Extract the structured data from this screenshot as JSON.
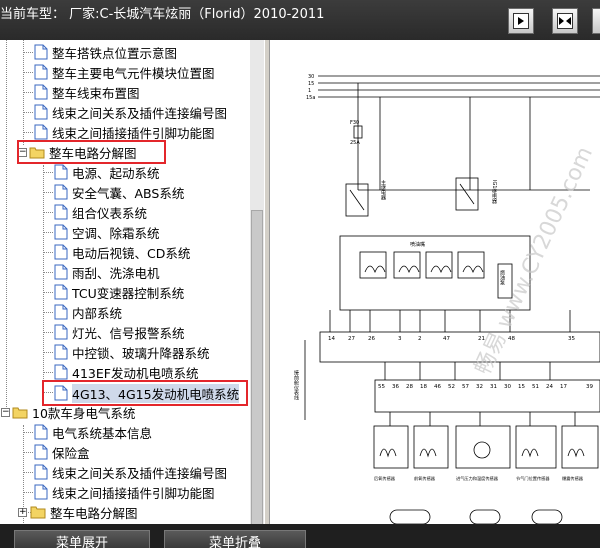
{
  "window": {
    "title": "当前车型：  厂家:C-长城汽车炫丽（Florid）2010-2011"
  },
  "toolbar": {
    "buttons": [
      {
        "name": "collapse-left-button",
        "icon": "arrow-right-box-icon"
      },
      {
        "name": "split-view-button",
        "icon": "double-arrow-box-icon"
      },
      {
        "name": "collapse-right-button",
        "icon": "arrow-left-box-icon"
      }
    ]
  },
  "tree": {
    "items": [
      {
        "label": "整车搭铁点位置示意图",
        "type": "doc"
      },
      {
        "label": "整车主要电气元件模块位置图",
        "type": "doc"
      },
      {
        "label": "整车线束布置图",
        "type": "doc"
      },
      {
        "label": "线束之间关系及插件连接编号图",
        "type": "doc"
      },
      {
        "label": "线束之间插接插件引脚功能图",
        "type": "doc"
      },
      {
        "label": "整车电路分解图",
        "type": "folder-open",
        "expander": "−"
      },
      {
        "label": "电源、起动系统",
        "type": "doc"
      },
      {
        "label": "安全气囊、ABS系统",
        "type": "doc"
      },
      {
        "label": "组合仪表系统",
        "type": "doc"
      },
      {
        "label": "空调、除霜系统",
        "type": "doc"
      },
      {
        "label": "电动后视镜、CD系统",
        "type": "doc"
      },
      {
        "label": "雨刮、洗涤电机",
        "type": "doc"
      },
      {
        "label": "TCU变速器控制系统",
        "type": "doc"
      },
      {
        "label": "内部系统",
        "type": "doc"
      },
      {
        "label": "灯光、信号报警系统",
        "type": "doc"
      },
      {
        "label": "中控锁、玻璃升降器系统",
        "type": "doc"
      },
      {
        "label": "413EF发动机电喷系统",
        "type": "doc"
      },
      {
        "label": "4G13、4G15发动机电喷系统",
        "type": "doc",
        "selected": true
      },
      {
        "label": "10款车身电气系统",
        "type": "folder-open",
        "expander": "−"
      },
      {
        "label": "电气系统基本信息",
        "type": "doc"
      },
      {
        "label": "保险盒",
        "type": "doc"
      },
      {
        "label": "线束之间关系及插件连接编号图",
        "type": "doc"
      },
      {
        "label": "线束之间插接插件引脚功能图",
        "type": "doc"
      },
      {
        "label": "整车电路分解图",
        "type": "folder-closed",
        "expander": "+"
      }
    ]
  },
  "bottom": {
    "expand_label": "菜单展开",
    "collapse_label": "菜单折叠"
  },
  "diagram": {
    "rails": [
      "30",
      "15",
      "1",
      "15a"
    ],
    "fuse_label": "F30",
    "fuse_rating": "25A",
    "relay_main": "主继电器",
    "ig_relay": "IG1继电器",
    "injector_label": "喷油嘴",
    "side_label": "燃油泵",
    "watermark": "畅易 www.CY2005.com",
    "pin_row_1": [
      "14",
      "27",
      "26",
      "3",
      "2",
      "47",
      "21",
      "48",
      "35"
    ],
    "pin_row_2": [
      "55",
      "36",
      "28",
      "18",
      "46",
      "52",
      "57",
      "32",
      "31",
      "30",
      "15",
      "51",
      "24",
      "17",
      "39"
    ],
    "harness_label": "接前舱仪表线",
    "sensor_labels": [
      "后氧传感器",
      "前氧传感器",
      "进气压力和温度传感器",
      "节气门位置传感器",
      "爆震传感器"
    ],
    "colors": {
      "line": "#000000",
      "accent": "#e3262b",
      "selection": "#cfd9ea"
    }
  }
}
